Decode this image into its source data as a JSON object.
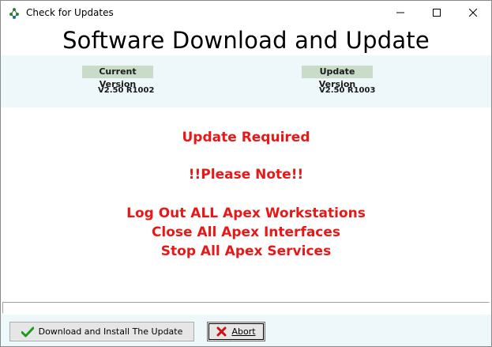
{
  "window": {
    "title": "Check for Updates",
    "controls": {
      "minimize": "minimize-icon",
      "maximize": "maximize-icon",
      "close": "close-icon"
    }
  },
  "heading": "Software Download and Update",
  "versions": {
    "current": {
      "label": "Current Version",
      "value": "V2.50 R1002"
    },
    "update": {
      "label": "Update Version",
      "value": "V2.50 R1003"
    }
  },
  "messages": {
    "status": "Update Required",
    "note": "!!Please Note!!",
    "instructions": [
      "Log Out ALL Apex Workstations",
      "Close All Apex Interfaces",
      "Stop All Apex Services"
    ]
  },
  "colors": {
    "alert": "#e81818",
    "band": "#eef8fb",
    "label_bg": "#c8dcc8"
  },
  "buttons": {
    "download": {
      "label": "Download and Install The Update",
      "icon": "checkmark-icon"
    },
    "abort": {
      "label": "Abort",
      "icon": "x-icon"
    }
  }
}
